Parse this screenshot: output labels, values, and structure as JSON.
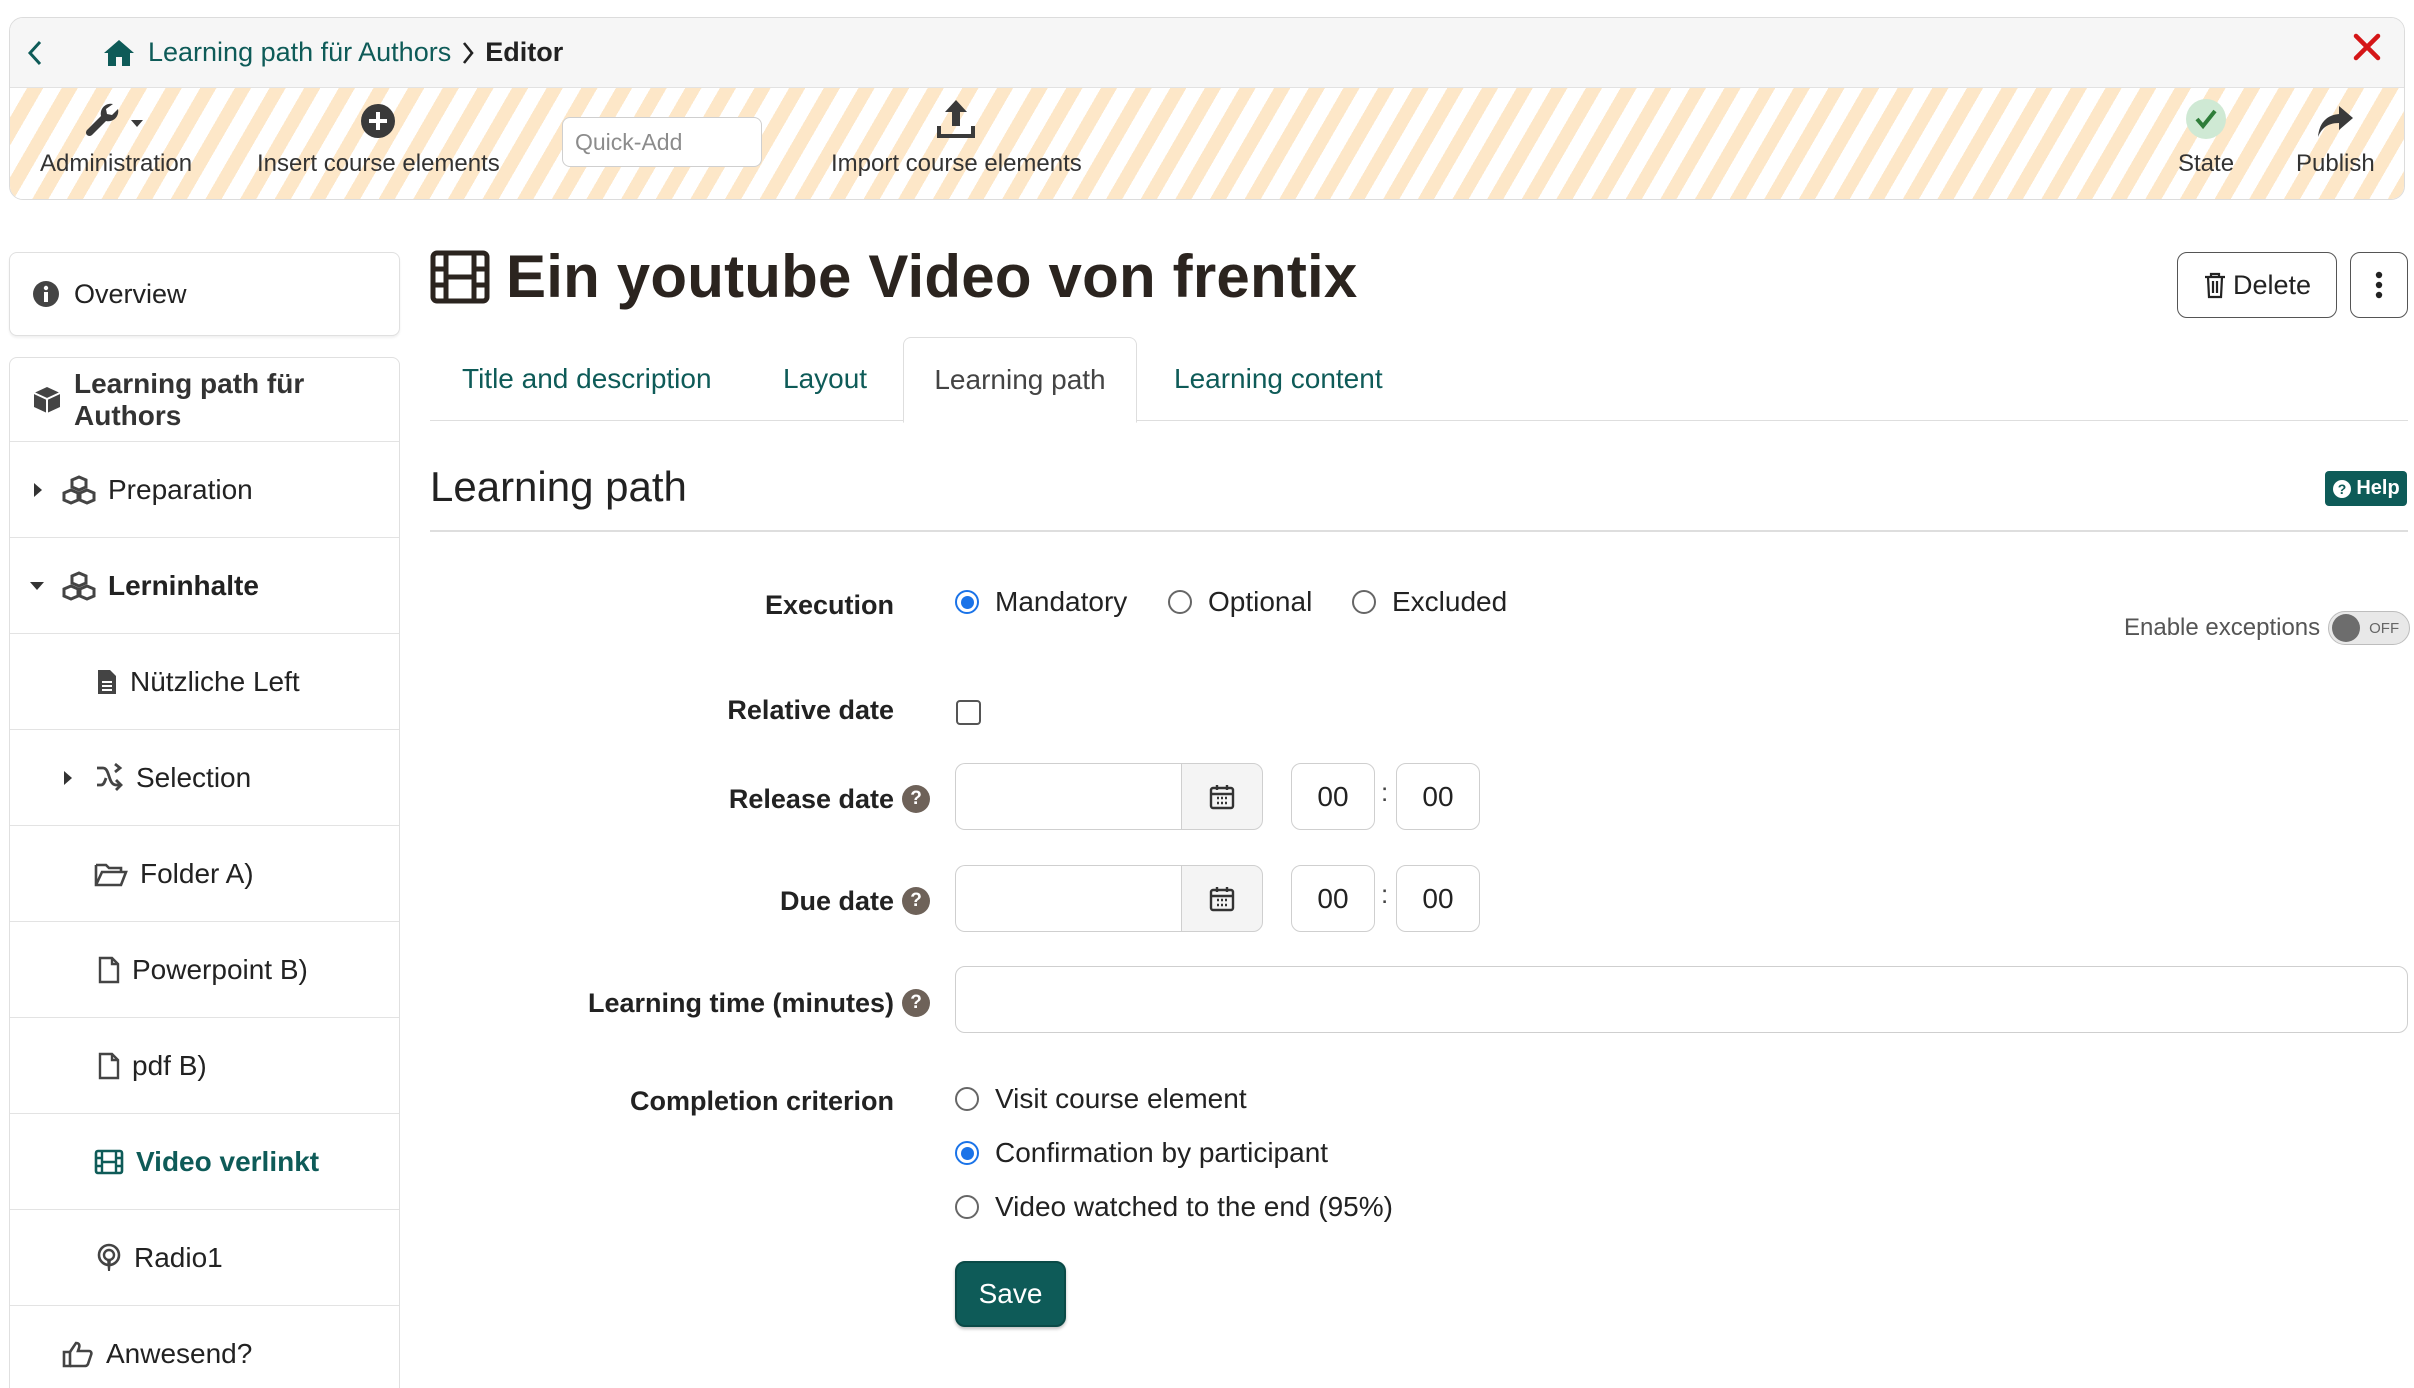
{
  "breadcrumb": {
    "course": "Learning path für Authors",
    "current": "Editor"
  },
  "toolbar": {
    "administration": "Administration",
    "insert": "Insert course elements",
    "quick_add_placeholder": "Quick-Add",
    "import": "Import course elements",
    "state": "State",
    "publish": "Publish"
  },
  "sidebar": {
    "overview": "Overview",
    "items": [
      {
        "label": "Learning path für Authors"
      },
      {
        "label": "Preparation"
      },
      {
        "label": "Lerninhalte"
      },
      {
        "label": "Nützliche Left"
      },
      {
        "label": "Selection"
      },
      {
        "label": "Folder A)"
      },
      {
        "label": "Powerpoint B)"
      },
      {
        "label": "pdf B)"
      },
      {
        "label": "Video verlinkt"
      },
      {
        "label": "Radio1"
      },
      {
        "label": "Anwesend?"
      }
    ]
  },
  "main": {
    "title": "Ein youtube Video von frentix",
    "delete": "Delete",
    "tabs": [
      "Title and description",
      "Layout",
      "Learning path",
      "Learning content"
    ],
    "section_title": "Learning path",
    "help": "Help"
  },
  "form": {
    "execution_label": "Execution",
    "execution_options": [
      "Mandatory",
      "Optional",
      "Excluded"
    ],
    "execution_selected": "Mandatory",
    "relative_date_label": "Relative date",
    "release_date_label": "Release date",
    "due_date_label": "Due date",
    "hour": "00",
    "minute": "00",
    "learning_time_label": "Learning time (minutes)",
    "completion_label": "Completion criterion",
    "completion_options": [
      "Visit course element",
      "Confirmation by participant",
      "Video watched to the end (95%)"
    ],
    "completion_selected": "Confirmation by participant",
    "save": "Save",
    "enable_exceptions": "Enable exceptions",
    "toggle_state": "OFF"
  },
  "colors": {
    "accent": "#0e5b58",
    "close": "#d51617",
    "radio": "#1a73e8"
  }
}
